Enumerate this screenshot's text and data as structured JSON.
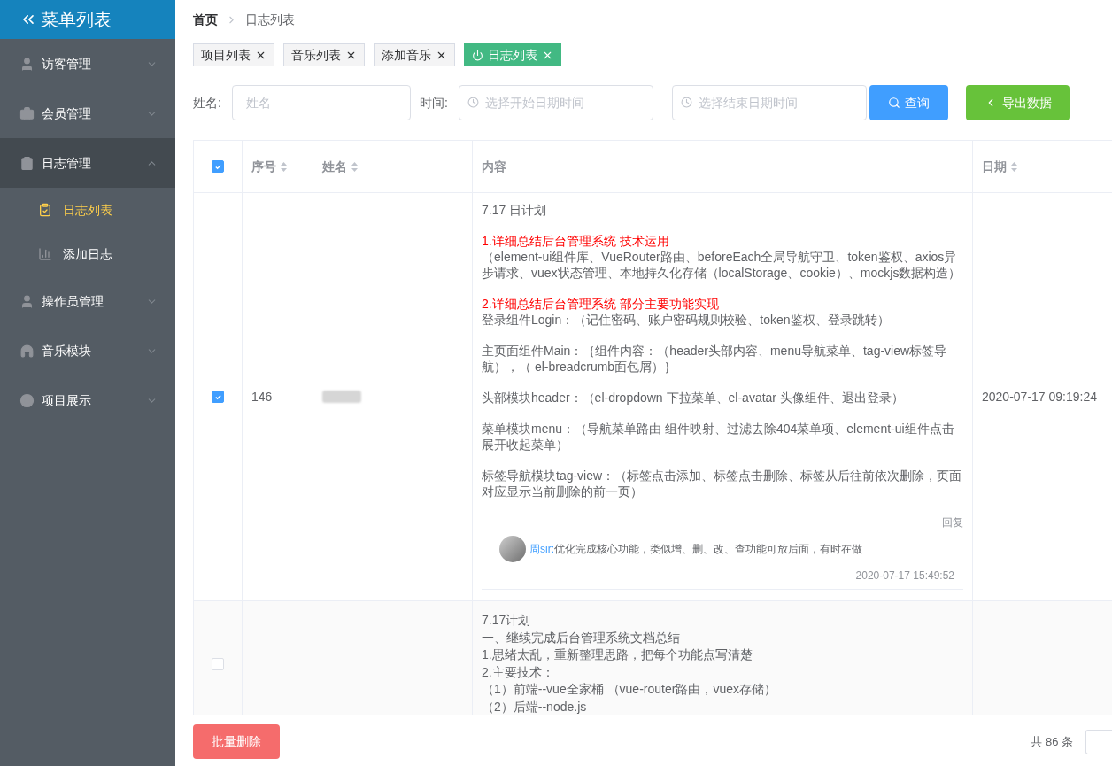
{
  "sidebar": {
    "title": "菜单列表",
    "items": [
      {
        "label": "访客管理",
        "expanded": false
      },
      {
        "label": "会员管理",
        "expanded": false
      },
      {
        "label": "日志管理",
        "expanded": true,
        "children": [
          {
            "label": "日志列表",
            "selected": true
          },
          {
            "label": "添加日志",
            "selected": false
          }
        ]
      },
      {
        "label": "操作员管理",
        "expanded": false
      },
      {
        "label": "音乐模块",
        "expanded": false
      },
      {
        "label": "项目展示",
        "expanded": false
      }
    ]
  },
  "breadcrumb": [
    {
      "label": "首页",
      "current": false
    },
    {
      "label": "日志列表",
      "current": true
    }
  ],
  "tags": [
    {
      "label": "项目列表",
      "selected": false
    },
    {
      "label": "音乐列表",
      "selected": false
    },
    {
      "label": "添加音乐",
      "selected": false
    },
    {
      "label": "日志列表",
      "selected": true
    }
  ],
  "filters": {
    "name_label": "姓名:",
    "name_placeholder": "姓名",
    "time_label": "时间:",
    "start_placeholder": "选择开始日期时间",
    "end_placeholder": "选择结束日期时间",
    "search_button": "查询",
    "export_button": "导出数据"
  },
  "table": {
    "select_all": true,
    "columns": [
      {
        "label": "序号",
        "sortable": true
      },
      {
        "label": "姓名",
        "sortable": true
      },
      {
        "label": "内容",
        "sortable": false
      },
      {
        "label": "日期",
        "sortable": true
      }
    ],
    "rows": [
      {
        "checked": true,
        "number": "146",
        "name_blurred": true,
        "date": "2020-07-17 09:19:24",
        "paragraphs": [
          [
            {
              "kind": "text",
              "text": "7.17 日计划"
            }
          ],
          [
            {
              "kind": "heading",
              "text": "1.详细总结后台管理系统 技术运用"
            },
            {
              "kind": "text",
              "text": "（element-ui组件库、VueRouter路由、beforeEach全局导航守卫、token鉴权、axios异步请求、vuex状态管理、本地持久化存储（localStorage、cookie）、mockjs数据构造）"
            }
          ],
          [
            {
              "kind": "heading",
              "text": "2.详细总结后台管理系统 部分主要功能实现"
            },
            {
              "kind": "text",
              "text": "登录组件Login：（记住密码、账户密码规则校验、token鉴权、登录跳转）"
            }
          ],
          [
            {
              "kind": "text",
              "text": "主页面组件Main：｛组件内容：（header头部内容、menu导航菜单、tag-view标签导航），（ el-breadcrumb面包屑）｝"
            }
          ],
          [
            {
              "kind": "text",
              "text": "头部模块header：（el-dropdown 下拉菜单、el-avatar 头像组件、退出登录）"
            }
          ],
          [
            {
              "kind": "text",
              "text": "菜单模块menu：（导航菜单路由 组件映射、过滤去除404菜单项、element-ui组件点击展开收起菜单）"
            }
          ],
          [
            {
              "kind": "text",
              "text": "标签导航模块tag-view：（标签点击添加、标签点击删除、标签从后往前依次删除，页面对应显示当前删除的前一页）"
            }
          ]
        ],
        "reply": {
          "label": "回复",
          "author": "周sir:",
          "comment": "优化完成核心功能，类似增、删、改、查功能可放后面，有时在做",
          "time": "2020-07-17 15:49:52"
        }
      },
      {
        "checked": false,
        "number": "",
        "name_blurred": false,
        "date": "",
        "paragraphs": [
          [
            {
              "kind": "text",
              "text": "7.17计划"
            },
            {
              "kind": "text",
              "text": "一、继续完成后台管理系统文档总结"
            },
            {
              "kind": "text",
              "text": "1.思绪太乱，重新整理思路，把每个功能点写清楚"
            },
            {
              "kind": "text",
              "text": "2.主要技术："
            },
            {
              "kind": "text",
              "text": "（1）前端--vue全家桶 （vue-router路由，vuex存储）"
            },
            {
              "kind": "text",
              "text": "（2）后端--node.js"
            }
          ]
        ]
      }
    ]
  },
  "footer": {
    "batch_delete": "批量删除",
    "total": "共 86 条"
  }
}
